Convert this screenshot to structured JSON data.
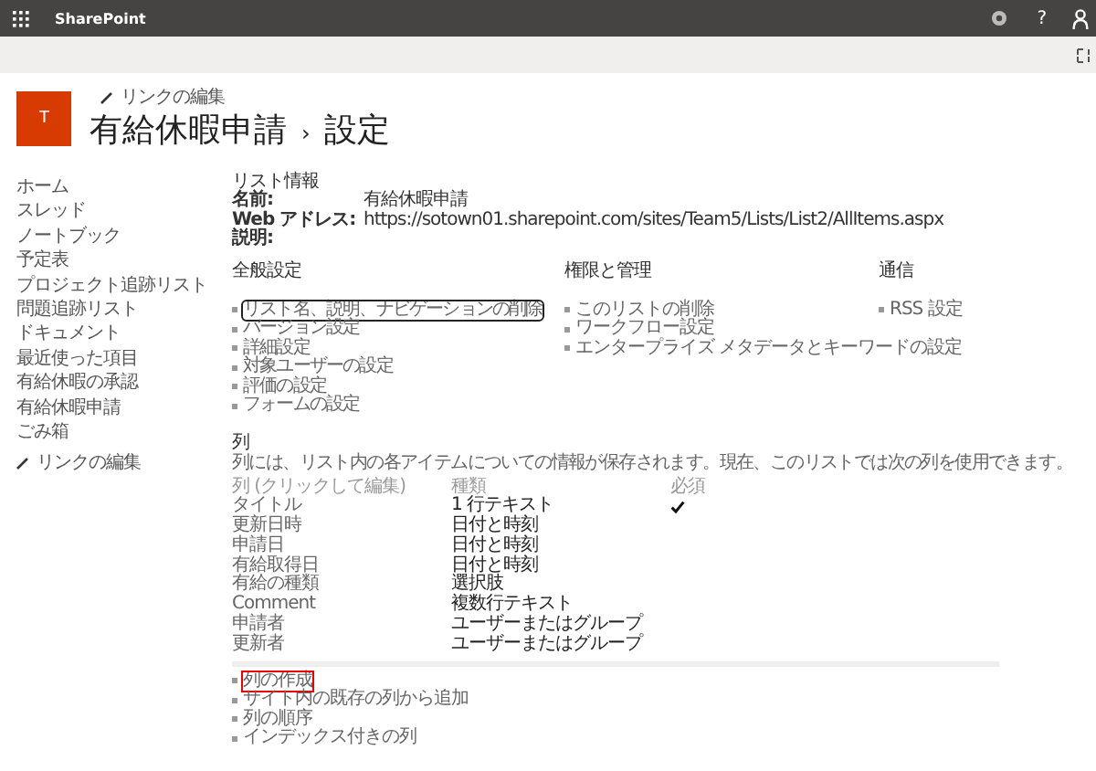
{
  "top_bar": {
    "app_name": "SharePoint",
    "help": "?"
  },
  "header": {
    "logo_letter": "T",
    "edit_links": "リンクの編集",
    "title": "有給休暇申請",
    "separator": "›",
    "subtitle": "設定"
  },
  "sidebar": {
    "items": [
      "ホーム",
      "スレッド",
      "ノートブック",
      "予定表",
      "プロジェクト追跡リスト",
      "問題追跡リスト",
      "ドキュメント",
      "最近使った項目",
      "有給休暇の承認",
      "有給休暇申請",
      "ごみ箱"
    ],
    "edit_links": "リンクの編集"
  },
  "list_info": {
    "heading": "リスト情報",
    "fields": [
      {
        "label": "名前:",
        "value": "有給休暇申請"
      },
      {
        "label": "Web アドレス:",
        "value": "https://sotown01.sharepoint.com/sites/Team5/Lists/List2/AllItems.aspx"
      },
      {
        "label": "説明:"
      }
    ]
  },
  "sections": [
    {
      "heading": "全般設定",
      "links": [
        {
          "text": "リスト名、説明、ナビゲーションの削除",
          "focused": true
        },
        {
          "text": "バージョン設定",
          "focused": false
        },
        {
          "text": "詳細設定",
          "focused": false
        },
        {
          "text": "対象ユーザーの設定",
          "focused": false
        },
        {
          "text": "評価の設定",
          "focused": false
        },
        {
          "text": "フォームの設定",
          "focused": false
        }
      ]
    },
    {
      "heading": "権限と管理",
      "links": [
        {
          "text": "このリストの削除",
          "focused": false
        },
        {
          "text": "ワークフロー設定",
          "focused": false
        },
        {
          "text": "エンタープライズ メタデータとキーワードの設定",
          "focused": false
        }
      ]
    },
    {
      "heading": "通信",
      "links": [
        {
          "text": "RSS 設定",
          "focused": false
        }
      ]
    }
  ],
  "columns": {
    "heading": "列",
    "description": "列には、リスト内の各アイテムについての情報が保存されます。現在、このリストでは次の列を使用できます。",
    "headers": [
      "列 (クリックして編集)",
      "種類",
      "必須"
    ],
    "rows": [
      {
        "name": "タイトル",
        "type": "1 行テキスト",
        "required": true
      },
      {
        "name": "更新日時",
        "type": "日付と時刻",
        "required": false
      },
      {
        "name": "申請日",
        "type": "日付と時刻",
        "required": false
      },
      {
        "name": "有給取得日",
        "type": "日付と時刻",
        "required": false
      },
      {
        "name": "有給の種類",
        "type": "選択肢",
        "required": false
      },
      {
        "name": "Comment",
        "type": "複数行テキスト",
        "required": false
      },
      {
        "name": "申請者",
        "type": "ユーザーまたはグループ",
        "required": false
      },
      {
        "name": "更新者",
        "type": "ユーザーまたはグループ",
        "required": false
      }
    ],
    "links": [
      {
        "text": "列の作成",
        "highlighted": true
      },
      {
        "text": "サイト内の既存の列から追加",
        "highlighted": false
      },
      {
        "text": "列の順序",
        "highlighted": false
      },
      {
        "text": "インデックス付きの列",
        "highlighted": false
      }
    ]
  }
}
